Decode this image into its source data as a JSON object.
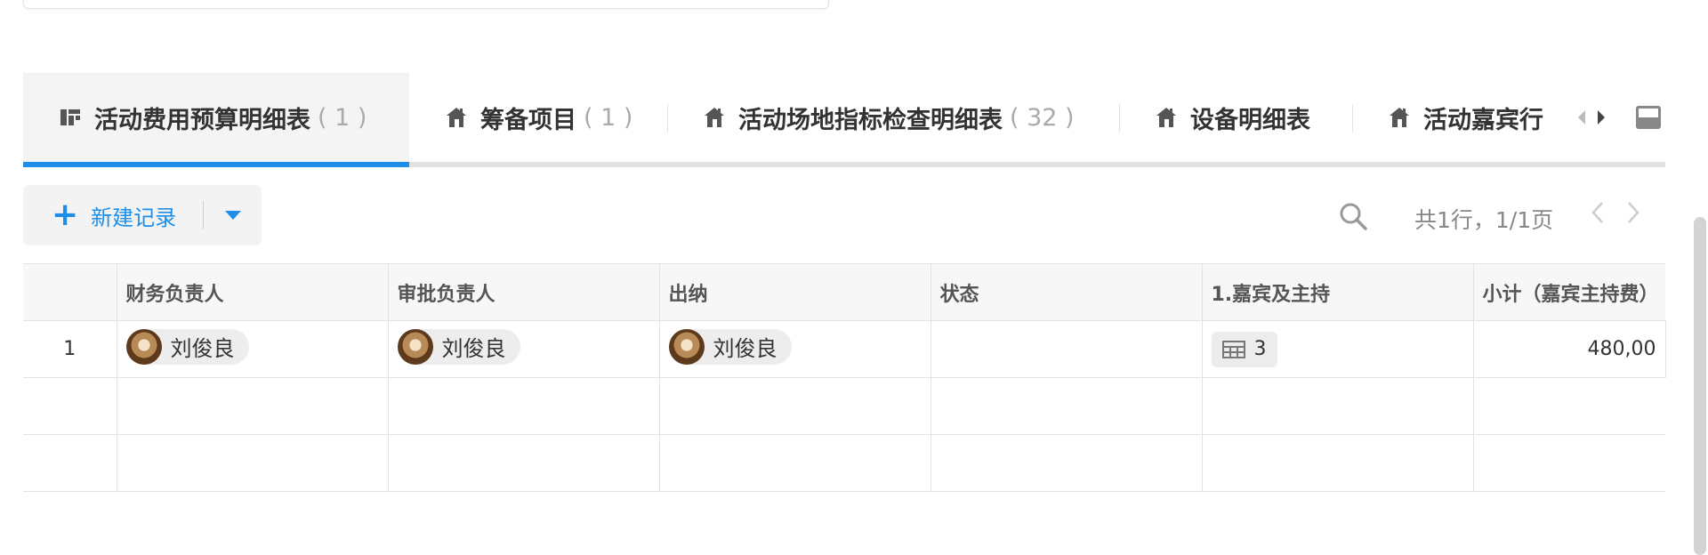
{
  "tabs": [
    {
      "label": "活动费用预算明细表",
      "count": "( 1 )",
      "icon": "grid-icon"
    },
    {
      "label": "筹备项目",
      "count": "( 1 )",
      "icon": "home-icon"
    },
    {
      "label": "活动场地指标检查明细表",
      "count": "( 32 )",
      "icon": "home-icon"
    },
    {
      "label": "设备明细表",
      "count": "",
      "icon": "home-icon"
    },
    {
      "label": "活动嘉宾行",
      "count": "",
      "icon": "home-icon"
    }
  ],
  "toolbar": {
    "new_record_label": "新建记录",
    "page_info": "共1行，1/1页"
  },
  "table": {
    "columns": [
      "财务负责人",
      "审批负责人",
      "出纳",
      "状态",
      "1.嘉宾及主持",
      "小计（嘉宾主持费）"
    ],
    "rows": [
      {
        "num": "1",
        "finance": "刘俊良",
        "approver": "刘俊良",
        "cashier": "刘俊良",
        "status": "",
        "guests_count": "3",
        "subtotal": "480,00"
      }
    ]
  },
  "colors": {
    "accent": "#1e8ee8",
    "tab_underline": "#e1e1e1"
  }
}
